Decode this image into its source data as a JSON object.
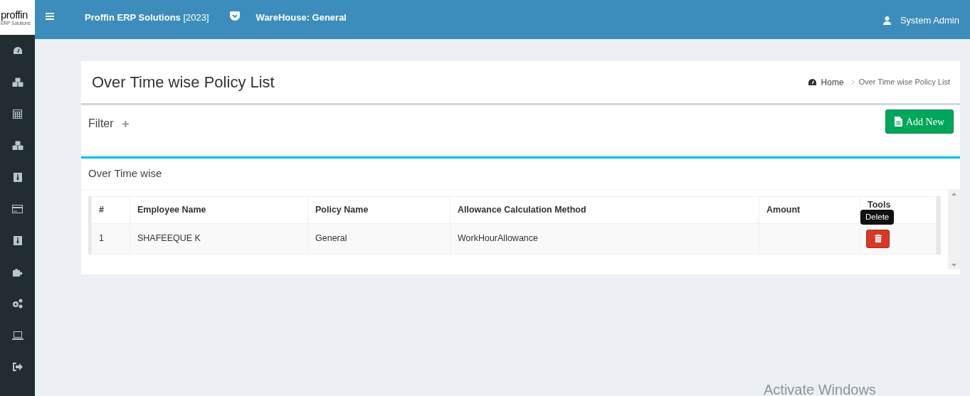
{
  "logo": {
    "text": "proffin",
    "subtitle": "ERP Solutions"
  },
  "navbar": {
    "app_name": "Proffin ERP Solutions",
    "year": "[2023]",
    "warehouse": "WareHouse: General",
    "user": "System Admin"
  },
  "sidebar": {
    "items": [
      {
        "kind": "dashboard"
      },
      {
        "kind": "cubes"
      },
      {
        "kind": "calculator"
      },
      {
        "kind": "cubes"
      },
      {
        "kind": "badge"
      },
      {
        "kind": "card"
      },
      {
        "kind": "badge"
      },
      {
        "kind": "puzzle"
      },
      {
        "kind": "gears"
      },
      {
        "kind": "laptop"
      },
      {
        "kind": "signout"
      }
    ]
  },
  "page": {
    "title": "Over Time wise Policy List",
    "breadcrumb": [
      "Home",
      "Over Time wise Policy List"
    ]
  },
  "filter": {
    "label": "Filter",
    "expanded": false
  },
  "add_button": "Add New",
  "box": {
    "title": "Over Time wise"
  },
  "table": {
    "columns": [
      "#",
      "Employee Name",
      "Policy Name",
      "Allowance Calculation Method",
      "Amount",
      "Tools"
    ],
    "rows": [
      {
        "cells": [
          "1",
          "SHAFEEQUE K",
          "General",
          "WorkHourAllowance",
          ""
        ],
        "tooltip": "Delete"
      }
    ]
  },
  "os_notice": "Activate Windows"
}
